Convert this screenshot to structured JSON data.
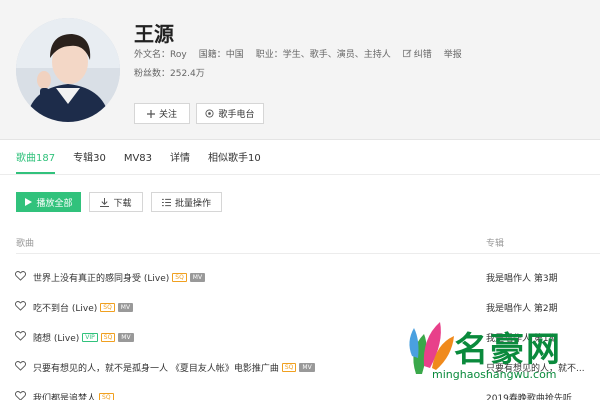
{
  "artist": {
    "name": "王源",
    "foreign_name": "外文名：Roy",
    "nationality": "国籍：中国",
    "occupation": "职业：学生、歌手、演员、主持人",
    "report_error": "纠错",
    "report": "举报",
    "fans": "粉丝数：252.4万",
    "follow_label": "关注",
    "radio_label": "歌手电台"
  },
  "tabs": [
    {
      "label": "歌曲187",
      "active": true
    },
    {
      "label": "专辑30",
      "active": false
    },
    {
      "label": "MV83",
      "active": false
    },
    {
      "label": "详情",
      "active": false
    },
    {
      "label": "相似歌手10",
      "active": false
    }
  ],
  "actions": {
    "play_all": "播放全部",
    "download": "下载",
    "batch": "批量操作"
  },
  "columns": {
    "song": "歌曲",
    "album": "专辑"
  },
  "songs": [
    {
      "title": "世界上没有真正的感同身受 (Live)",
      "badges": [
        "SQ",
        "MV"
      ],
      "album": "我是唱作人 第3期"
    },
    {
      "title": "吃不到台 (Live)",
      "badges": [
        "SQ",
        "MV"
      ],
      "album": "我是唱作人 第2期"
    },
    {
      "title": "随想 (Live)",
      "badges": [
        "VIP",
        "SQ",
        "MV"
      ],
      "album": "我是唱作人 第1期"
    },
    {
      "title": "只要有想见的人，就不是孤身一人 《夏目友人帐》电影推广曲",
      "badges": [
        "SQ",
        "MV"
      ],
      "album": "只要有想见的人，就不..."
    },
    {
      "title": "我们都是追梦人",
      "badges": [
        "SQ"
      ],
      "album": "2019春晚歌曲抢先听"
    }
  ],
  "watermark": {
    "text": "名豪网",
    "url": "minghaoshangwu.com"
  },
  "colors": {
    "accent": "#31c27c",
    "badge_sq": "#f0a020",
    "watermark": "#0a8a3c"
  }
}
